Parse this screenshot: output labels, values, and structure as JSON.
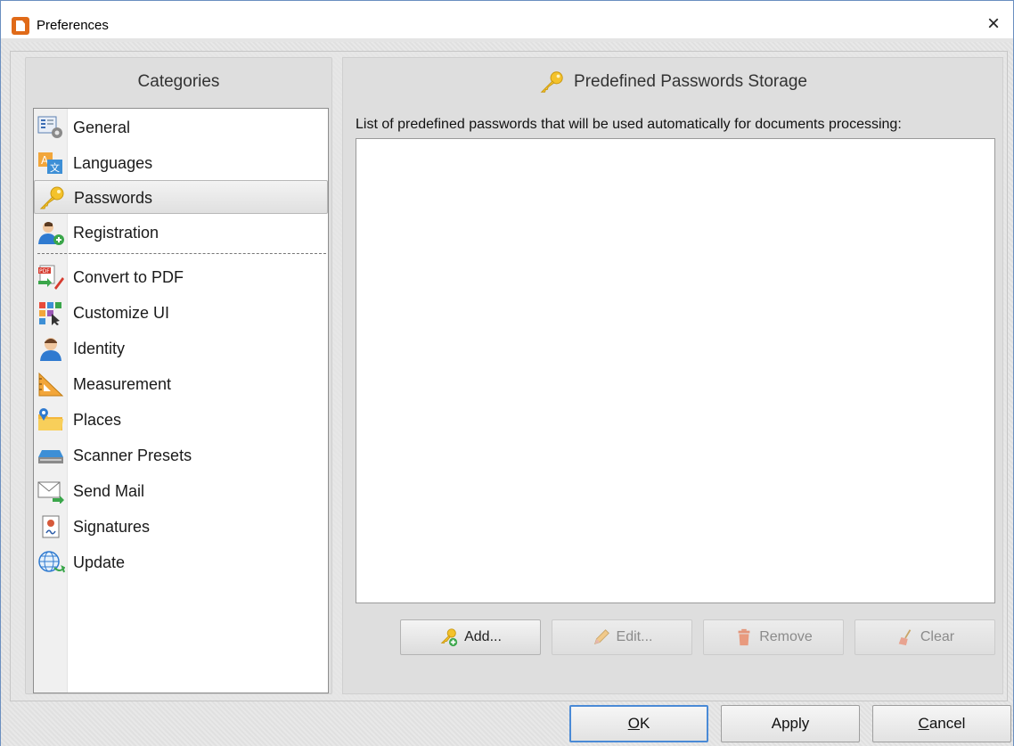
{
  "window": {
    "title": "Preferences",
    "close_glyph": "×",
    "accent_color": "#4a8ad6"
  },
  "categories": {
    "header": "Categories",
    "items": [
      {
        "label": "General",
        "icon": "general-settings-icon"
      },
      {
        "label": "Languages",
        "icon": "languages-icon"
      },
      {
        "label": "Passwords",
        "icon": "key-icon",
        "selected": true
      },
      {
        "label": "Registration",
        "icon": "registration-user-icon"
      },
      {
        "label": "Convert to PDF",
        "icon": "convert-to-pdf-icon"
      },
      {
        "label": "Customize UI",
        "icon": "customize-ui-icon"
      },
      {
        "label": "Identity",
        "icon": "identity-user-icon"
      },
      {
        "label": "Measurement",
        "icon": "measurement-ruler-icon"
      },
      {
        "label": "Places",
        "icon": "places-folder-icon"
      },
      {
        "label": "Scanner Presets",
        "icon": "scanner-icon"
      },
      {
        "label": "Send Mail",
        "icon": "mail-icon"
      },
      {
        "label": "Signatures",
        "icon": "signature-certificate-icon"
      },
      {
        "label": "Update",
        "icon": "update-globe-icon"
      }
    ]
  },
  "panel": {
    "title": "Predefined Passwords Storage",
    "title_icon": "key-icon",
    "description": "List of predefined passwords that will be used automatically for documents processing:",
    "passwords": [],
    "buttons": {
      "add": "Add...",
      "edit": "Edit...",
      "remove": "Remove",
      "clear": "Clear"
    }
  },
  "footer": {
    "ok_accel": "O",
    "ok_rest": "K",
    "apply": "Apply",
    "cancel_accel": "C",
    "cancel_rest": "ancel"
  }
}
